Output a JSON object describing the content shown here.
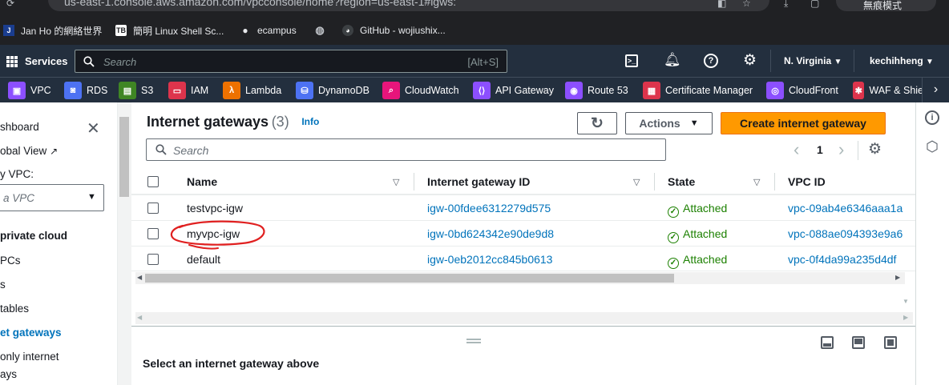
{
  "browser": {
    "url": "us-east-1.console.aws.amazon.com/vpcconsole/home?region=us-east-1#igws:",
    "profile_label": "無痕模式",
    "bookmarks": [
      {
        "label": "Jan Ho 的網絡世界",
        "icon": "J"
      },
      {
        "label": "簡明 Linux Shell Sc...",
        "icon": "TB"
      },
      {
        "label": "ecampus",
        "icon": "ecampus-icon"
      },
      {
        "label": "",
        "icon": "globe-icon"
      },
      {
        "label": "GitHub - wojiushix...",
        "icon": "github-icon"
      }
    ]
  },
  "aws_nav": {
    "services_label": "Services",
    "search_placeholder": "Search",
    "search_shortcut": "[Alt+S]",
    "region": "N. Virginia",
    "user": "kechihheng"
  },
  "service_shortcuts": [
    {
      "label": "VPC",
      "color": "#8c4fff"
    },
    {
      "label": "RDS",
      "color": "#4d72f3"
    },
    {
      "label": "S3",
      "color": "#3f8624"
    },
    {
      "label": "IAM",
      "color": "#dd344c"
    },
    {
      "label": "Lambda",
      "color": "#ed7100"
    },
    {
      "label": "DynamoDB",
      "color": "#4d72f3"
    },
    {
      "label": "CloudWatch",
      "color": "#e7157b"
    },
    {
      "label": "API Gateway",
      "color": "#8c4fff"
    },
    {
      "label": "Route 53",
      "color": "#8c4fff"
    },
    {
      "label": "Certificate Manager",
      "color": "#dd344c"
    },
    {
      "label": "CloudFront",
      "color": "#8c4fff"
    },
    {
      "label": "WAF & Shie",
      "color": "#dd344c"
    }
  ],
  "sidebar": {
    "dashboard": "shboard",
    "global_view": "obal View",
    "filter_label": "y VPC:",
    "filter_value": "a VPC",
    "section": " private cloud",
    "items": [
      "PCs",
      "s",
      "tables",
      "et gateways",
      "only internet",
      "ays"
    ]
  },
  "main": {
    "title": "Internet gateways",
    "count": "(3)",
    "info": "Info",
    "actions": "Actions",
    "create": "Create internet gateway",
    "search_placeholder": "Search",
    "page": "1",
    "columns": [
      "Name",
      "Internet gateway ID",
      "State",
      "VPC ID"
    ],
    "rows": [
      {
        "name": "testvpc-igw",
        "id": "igw-00fdee6312279d575",
        "state": "Attached",
        "vpc": "vpc-09ab4e6346aaa1a"
      },
      {
        "name": "myvpc-igw",
        "id": "igw-0bd624342e90de9d8",
        "state": "Attached",
        "vpc": "vpc-088ae094393e9a6"
      },
      {
        "name": "default",
        "id": "igw-0eb2012cc845b0613",
        "state": "Attached",
        "vpc": "vpc-0f4da99a235d4df"
      }
    ],
    "details_prompt": "Select an internet gateway above"
  },
  "colors": {
    "accent": "#ff9900",
    "annotation": "#e02020"
  }
}
